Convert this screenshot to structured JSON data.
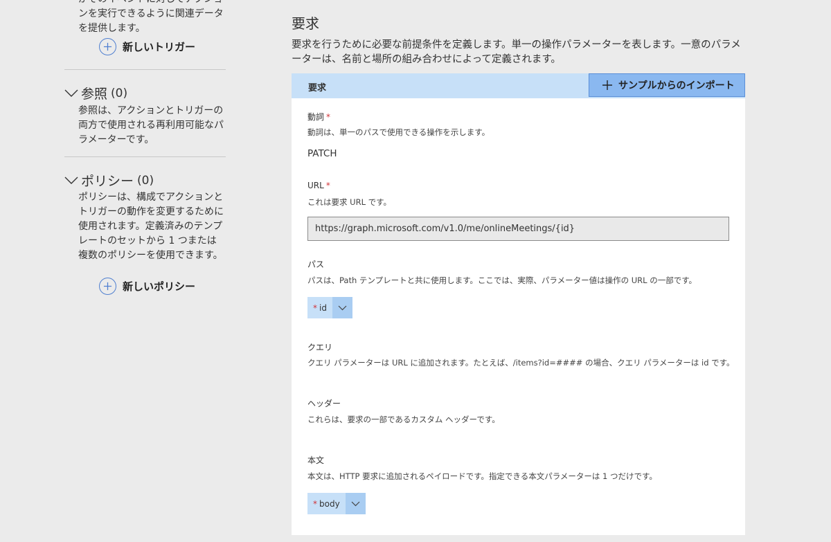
{
  "left_panel": {
    "trigger_desc": "がそのイベントに対してアクションを実行できるように関連データを提供します。",
    "new_trigger_label": "新しいトリガー",
    "references": {
      "title": "参照",
      "count": "(0)",
      "description": "参照は、アクションとトリガーの両方で使用される再利用可能なパラメーターです。"
    },
    "policies": {
      "title": "ポリシー",
      "count": "(0)",
      "description": "ポリシーは、構成でアクションとトリガーの動作を変更するために使用されます。定義済みのテンプレートのセットから 1 つまたは複数のポリシーを使用できます。"
    },
    "new_policy_label": "新しいポリシー"
  },
  "request": {
    "title": "要求",
    "description": "要求を行うために必要な前提条件を定義します。単一の操作パラメーターを表します。一意のパラメーターは、名前と場所の組み合わせによって定義されます。",
    "header_label": "要求",
    "import_button_label": "サンプルからのインポート",
    "verb": {
      "label": "動詞",
      "required_mark": "*",
      "description": "動詞は、単一のパスで使用できる操作を示します。",
      "value": "PATCH"
    },
    "url": {
      "label": "URL",
      "required_mark": "*",
      "description": "これは要求 URL です。",
      "value": "https://graph.microsoft.com/v1.0/me/onlineMeetings/{id}"
    },
    "path": {
      "label": "パス",
      "description": "パスは、Path テンプレートと共に使用します。ここでは、実際、パラメーター値は操作の URL の一部です。",
      "params": [
        {
          "required_mark": "*",
          "name": "id"
        }
      ]
    },
    "query": {
      "label": "クエリ",
      "description": "クエリ パラメーターは URL に追加されます。たとえば、/items?id=#### の場合、クエリ パラメーターは id です。"
    },
    "headers": {
      "label": "ヘッダー",
      "description": "これらは、要求の一部であるカスタム ヘッダーです。"
    },
    "body": {
      "label": "本文",
      "description": "本文は、HTTP 要求に追加されるペイロードです。指定できる本文パラメーターは 1 つだけです。",
      "params": [
        {
          "required_mark": "*",
          "name": "body"
        }
      ]
    }
  },
  "colors": {
    "accent": "#4f7fd0",
    "header_bg": "#c7e0f8",
    "import_button_bg": "#8ab8f0",
    "required": "#d13438"
  }
}
